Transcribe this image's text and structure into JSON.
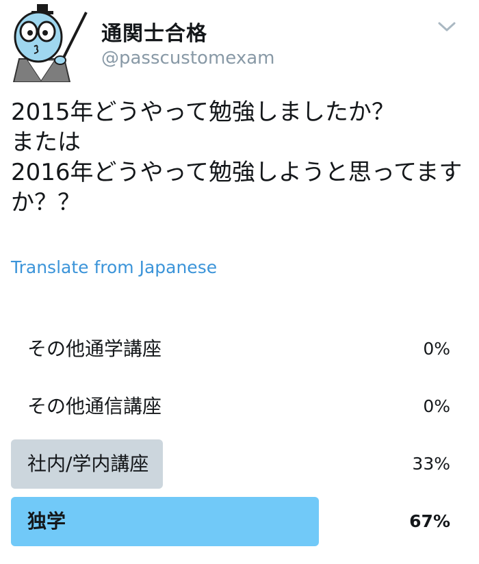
{
  "header": {
    "display_name": "通関士合格",
    "handle": "@passcustomexam",
    "avatar_icon": "cartoon-avatar-icon",
    "menu_icon": "chevron-down-icon"
  },
  "tweet": {
    "lines": [
      "2015年どうやって勉強しましたか？",
      "または",
      "2016年どうやって勉強しようと思ってます",
      "か？？"
    ],
    "translate_label": "Translate from Japanese"
  },
  "poll": {
    "options": [
      {
        "label": "その他通学講座",
        "percent": "0%",
        "fraction": 0.0
      },
      {
        "label": "その他通信講座",
        "percent": "0%",
        "fraction": 0.0
      },
      {
        "label": "社内/学内講座",
        "percent": "33%",
        "fraction": 0.33
      },
      {
        "label": "独学",
        "percent": "67%",
        "fraction": 0.67
      }
    ],
    "winner_color": "#71c9f8",
    "other_color": "#ccd6dd"
  }
}
